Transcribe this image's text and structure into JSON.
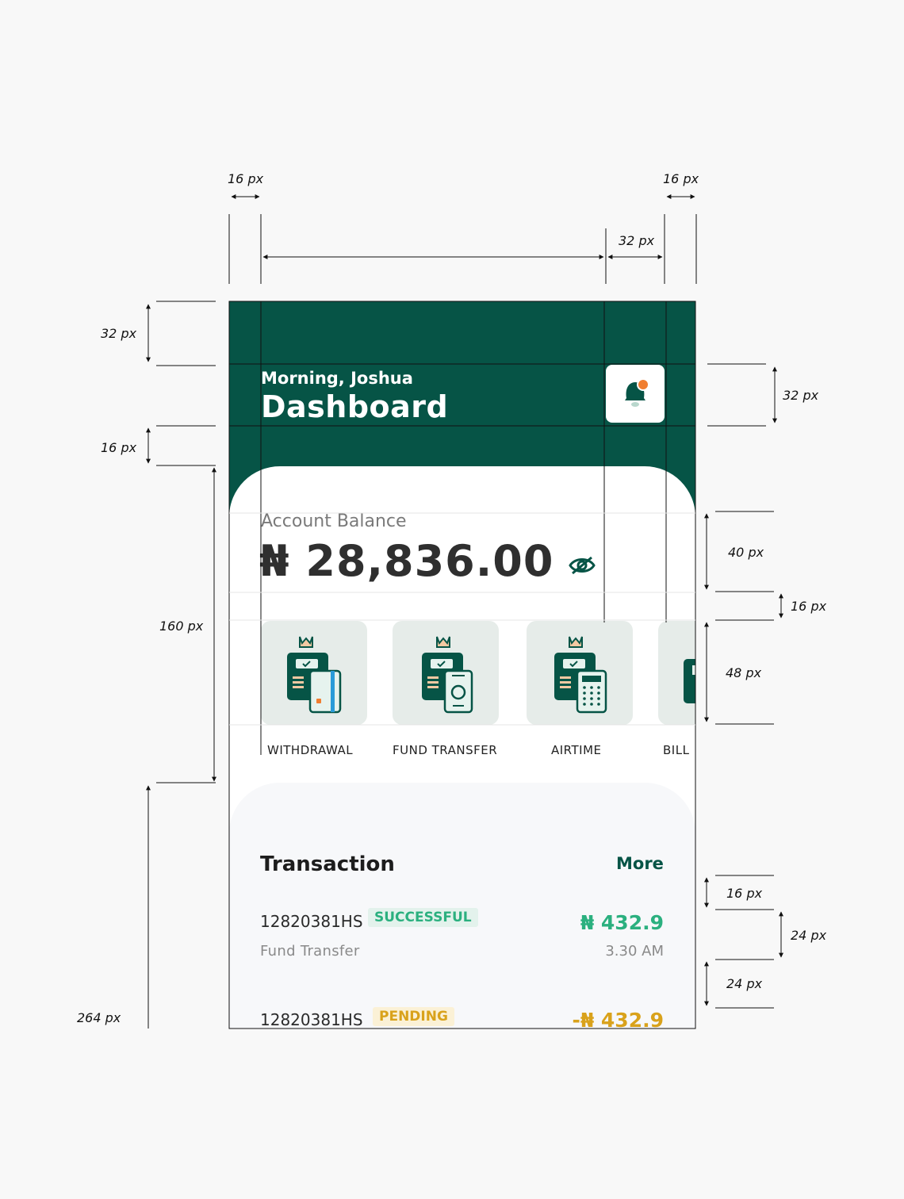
{
  "header": {
    "greeting": "Morning, Joshua",
    "title": "Dashboard"
  },
  "balance": {
    "label": "Account Balance",
    "amount": "₦ 28,836.00"
  },
  "actions": [
    {
      "label": "WITHDRAWAL"
    },
    {
      "label": "FUND TRANSFER"
    },
    {
      "label": "AIRTIME"
    },
    {
      "label": "BILL"
    }
  ],
  "transactions": {
    "title": "Transaction",
    "more": "More",
    "items": [
      {
        "ref": "12820381HS",
        "status": "SUCCESSFUL",
        "type": "Fund Transfer",
        "amount": "₦ 432.9",
        "time": "3.30 AM"
      },
      {
        "ref": "12820381HS",
        "status": "PENDING",
        "amount": "-₦ 432.9"
      }
    ]
  },
  "annotations": {
    "top_left_margin": "16 px",
    "top_right_margin": "16 px",
    "notif_width": "32 px",
    "header_top": "32 px",
    "header_text_gap": "16 px",
    "notif_height": "32 px",
    "card_height": "160 px",
    "balance_height": "40 px",
    "gap_under_balance": "16 px",
    "tile_height": "48 px",
    "txn_section_height": "264 px",
    "txn_row_gap": "16 px",
    "txn_row_height": "24 px",
    "txn_row_spacing": "24 px"
  },
  "colors": {
    "brand_green": "#065446",
    "success": "#2bb07f",
    "pending": "#d9a21b",
    "notification_dot": "#f07e30"
  },
  "icons": [
    "bell-icon",
    "eye-icon",
    "withdrawal-icon",
    "fund-transfer-icon",
    "airtime-icon",
    "bill-icon"
  ]
}
